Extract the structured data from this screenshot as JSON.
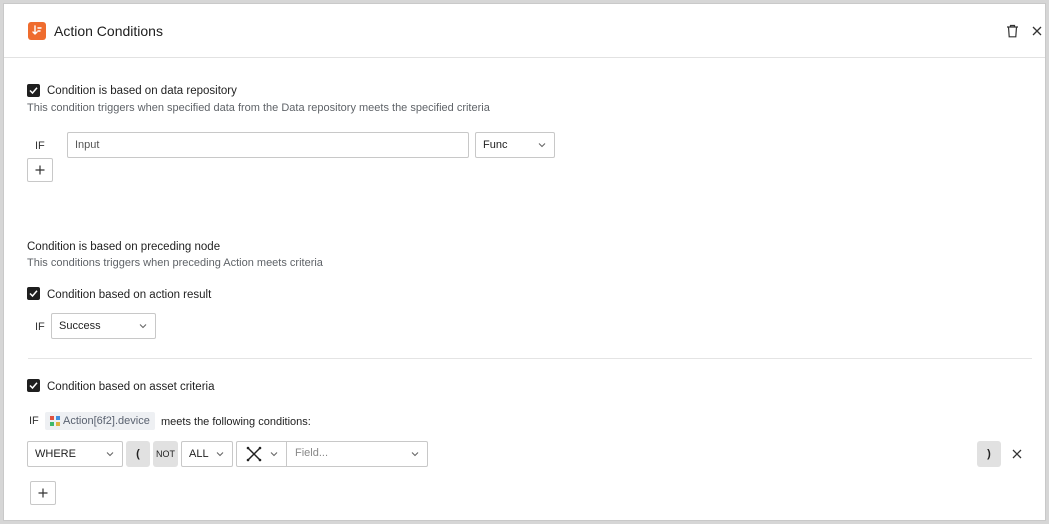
{
  "header": {
    "title": "Action Conditions"
  },
  "data_repository": {
    "checkbox_label": "Condition is based on data repository",
    "checked": true,
    "description": "This condition triggers when specified data from the Data repository meets the specified criteria",
    "if_label": "IF",
    "input_placeholder": "Input",
    "func_select": "Func"
  },
  "preceding_node": {
    "heading": "Condition is based on preceding node",
    "description": "This conditions triggers when preceding Action meets criteria",
    "action_result": {
      "checkbox_label": "Condition based on action result",
      "checked": true,
      "if_label": "IF",
      "result_select": "Success"
    },
    "asset_criteria": {
      "checkbox_label": "Condition based on asset criteria",
      "checked": true,
      "if_label": "IF",
      "asset_chip": "Action[6f2].device",
      "meets_text": "meets the following conditions:",
      "where_select": "WHERE",
      "open_paren": "(",
      "not_label": "NOT",
      "all_select": "ALL",
      "field_placeholder": "Field...",
      "close_paren": ")"
    }
  },
  "colors": {
    "accent": "#ef6c2e",
    "checkbox": "#1f1f1f",
    "chip_bg": "#eef0f3"
  }
}
